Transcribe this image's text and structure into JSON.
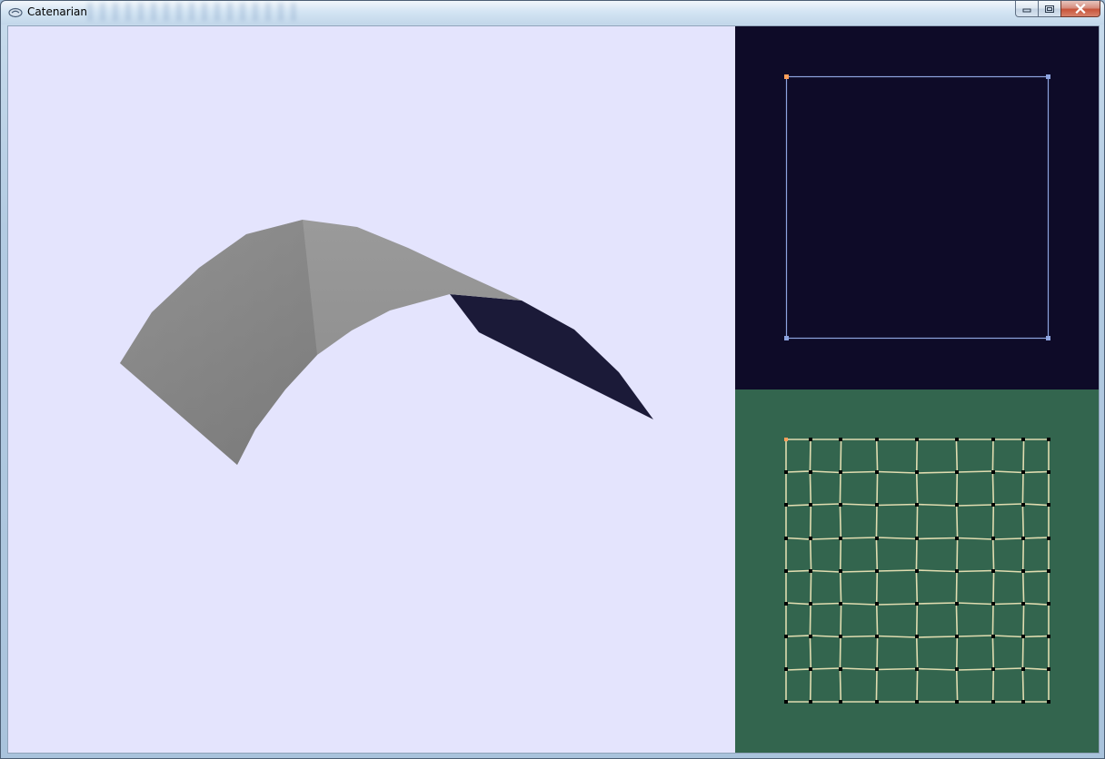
{
  "window": {
    "title": "Catenarian",
    "icon": "app-icon",
    "buttons": [
      "minimize-icon",
      "maximize-icon",
      "close-icon"
    ]
  },
  "colors": {
    "viewport_bg": "#e4e4fd",
    "surface_top": "#939393",
    "surface_front": "#7a7a7a",
    "surface_back": "#1a1a38",
    "boundary_panel_bg": "#0e0b28",
    "boundary_line": "#8ea4df",
    "selected_point": "#ff9f5a",
    "mesh_panel_bg": "#33654e",
    "mesh_line": "#e0dcb0",
    "mesh_node": "#000000"
  },
  "boundary_panel": {
    "shape": "square",
    "corner_count": 4
  },
  "mesh_panel": {
    "grid_columns": 9,
    "grid_rows": 9
  }
}
